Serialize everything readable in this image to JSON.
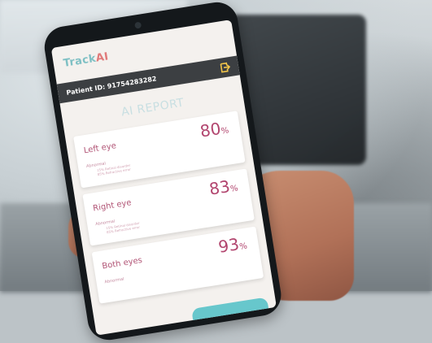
{
  "app": {
    "brand_prefix": "Track",
    "brand_suffix": "AI",
    "patient_id": "Patient ID: 91754283282",
    "report_title": "AI REPORT"
  },
  "results": [
    {
      "label": "Left eye",
      "percent": "80",
      "unit": "%",
      "status": "Abnormal",
      "notes": [
        "15% Retinal disorder",
        "85% Refractive error"
      ]
    },
    {
      "label": "Right eye",
      "percent": "83",
      "unit": "%",
      "status": "Abnormal",
      "notes": [
        "15% Retinal disorder",
        "85% Refractive error"
      ]
    },
    {
      "label": "Both eyes",
      "percent": "93",
      "unit": "%",
      "status": "Abnormal",
      "notes": []
    }
  ],
  "colors": {
    "brand_teal": "#7fc0c4",
    "brand_ai": "#e07a7a",
    "percent_magenta": "#b2466f",
    "header_bar": "#3c3f42",
    "logout_icon": "#f3c64a"
  },
  "icons": {
    "logout": "logout-icon",
    "camera": "camera-icon"
  }
}
